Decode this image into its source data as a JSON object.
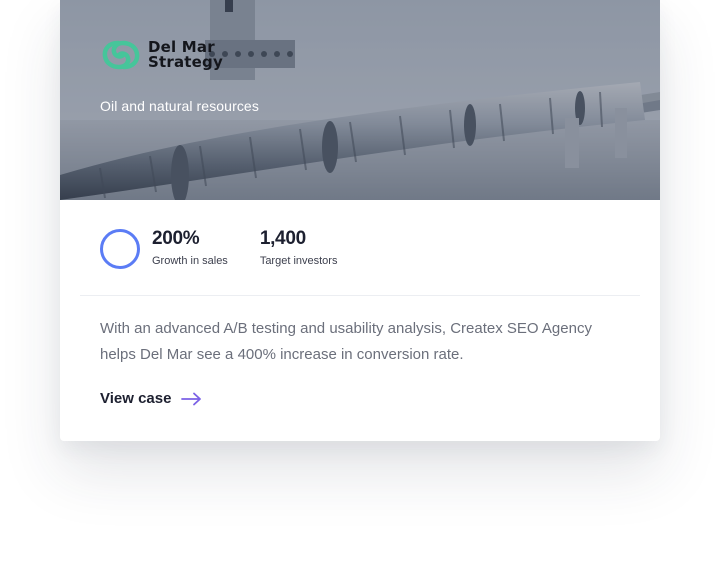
{
  "card": {
    "brand": {
      "logo_icon": "wave-logo-icon",
      "name_line1": "Del Mar",
      "name_line2": "Strategy",
      "logo_color": "#46c59a"
    },
    "category": "Oil and natural resources",
    "stats": [
      {
        "value": "200%",
        "label": "Growth in sales",
        "icon": "progress-ring-icon",
        "icon_color": "#5b7cf5"
      },
      {
        "value": "1,400",
        "label": "Target investors"
      }
    ],
    "description": "With an advanced A/B testing and usability analysis, Createx SEO Agency helps Del Mar see a 400% increase in conversion rate.",
    "cta": {
      "label": "View case",
      "icon": "arrow-right-icon",
      "icon_color": "#7b61e6"
    }
  }
}
